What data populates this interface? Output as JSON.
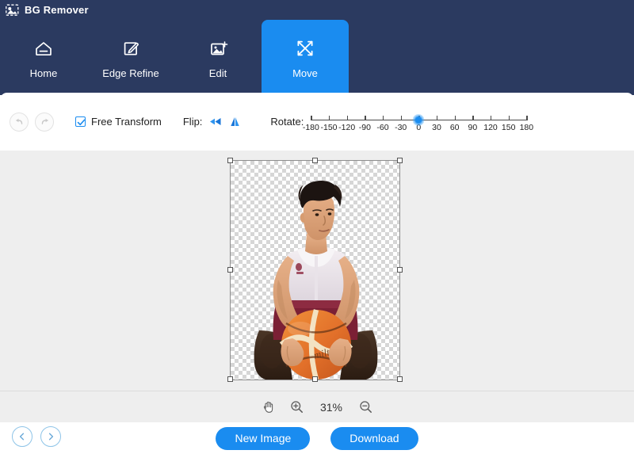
{
  "window": {
    "title": "BG Remover",
    "icon": "image-photo-icon"
  },
  "nav": {
    "tabs": [
      {
        "label": "Home",
        "icon": "home-icon",
        "active": false
      },
      {
        "label": "Edge Refine",
        "icon": "pen-edit-square-icon",
        "active": false
      },
      {
        "label": "Edit",
        "icon": "image-plus-icon",
        "active": false
      },
      {
        "label": "Move",
        "icon": "move-arrows-icon",
        "active": true
      }
    ],
    "active_tab": "Move"
  },
  "toolbar": {
    "undo_icon": "undo-arrow-icon",
    "redo_icon": "redo-arrow-icon",
    "undo_enabled": false,
    "redo_enabled": false,
    "free_transform_label": "Free Transform",
    "free_transform_checked": true,
    "flip_label": "Flip:",
    "flip_horizontal_icon": "flip-horizontal-icon",
    "flip_vertical_icon": "flip-vertical-icon",
    "rotate_label": "Rotate:",
    "rotate_value": 0,
    "rotate_min": -180,
    "rotate_max": 180,
    "rotate_ticks": [
      -180,
      -150,
      -120,
      -90,
      -60,
      -30,
      0,
      30,
      60,
      90,
      120,
      150,
      180
    ]
  },
  "canvas": {
    "transparent_background": true,
    "selection_active": true,
    "subject_description": "young man in white tank top and maroon shorts holding an orange basketball"
  },
  "zoom_controls": {
    "hand_tool_icon": "hand-icon",
    "zoom_in_icon": "zoom-in-icon",
    "zoom_out_icon": "zoom-out-icon",
    "zoom_level": "31%"
  },
  "footer": {
    "prev_icon": "chevron-left-icon",
    "next_icon": "chevron-right-icon",
    "new_image_label": "New Image",
    "download_label": "Download"
  },
  "colors": {
    "header_navy": "#2b3a60",
    "accent_blue": "#1a8cf0",
    "canvas_gray": "#eeeeee",
    "nav_circle_border": "#8ec4e8"
  }
}
